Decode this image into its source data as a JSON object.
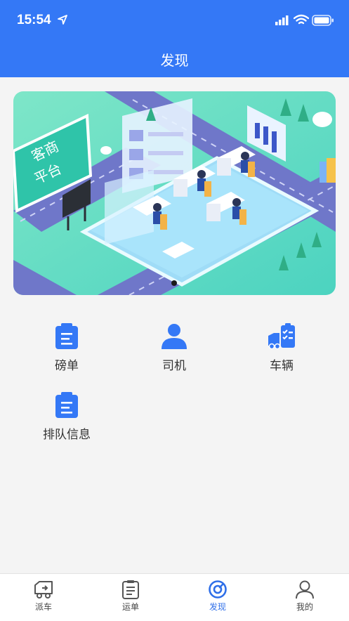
{
  "status_bar": {
    "time": "15:54"
  },
  "header": {
    "title": "发现"
  },
  "banner": {
    "sign_text_line1": "客商",
    "sign_text_line2": "平台",
    "page_count": 1,
    "active_page": 1
  },
  "grid": {
    "items": [
      {
        "label": "磅单",
        "icon": "document-icon"
      },
      {
        "label": "司机",
        "icon": "person-icon"
      },
      {
        "label": "车辆",
        "icon": "truck-icon"
      },
      {
        "label": "排队信息",
        "icon": "document-icon"
      }
    ]
  },
  "tabbar": {
    "items": [
      {
        "label": "派车",
        "icon": "truck-outline-icon",
        "active": false
      },
      {
        "label": "运单",
        "icon": "list-doc-icon",
        "active": false
      },
      {
        "label": "发现",
        "icon": "compass-icon",
        "active": true
      },
      {
        "label": "我的",
        "icon": "user-icon",
        "active": false
      }
    ]
  },
  "colors": {
    "primary": "#3478f6",
    "active_tab": "#2f6fe8",
    "background": "#f4f4f4"
  }
}
